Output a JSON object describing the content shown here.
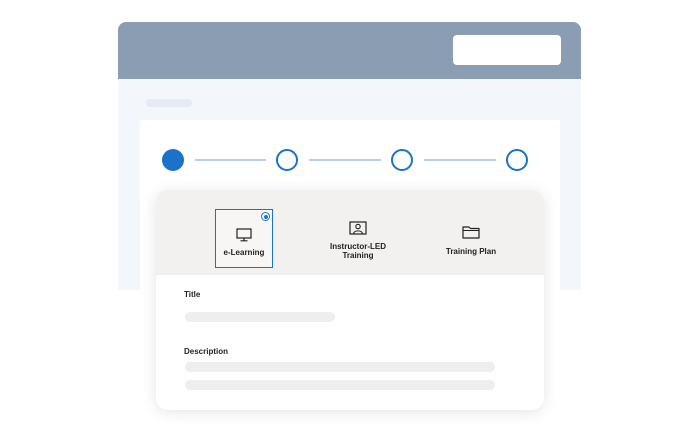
{
  "stepper": {
    "steps": [
      {
        "state": "active"
      },
      {
        "state": "inactive"
      },
      {
        "state": "inactive"
      },
      {
        "state": "inactive"
      }
    ],
    "active_color": "#1a73c8"
  },
  "options": [
    {
      "label": "e-Learning",
      "icon": "monitor-icon",
      "selected": true
    },
    {
      "label": "Instructor-LED\nTraining",
      "icon": "presenter-icon",
      "selected": false
    },
    {
      "label": "Training Plan",
      "icon": "folder-icon",
      "selected": false
    }
  ],
  "form": {
    "title_label": "Title",
    "description_label": "Description"
  },
  "colors": {
    "header": "#8a9db3",
    "accent": "#1a73c8",
    "card_top": "#f2f1ef"
  }
}
